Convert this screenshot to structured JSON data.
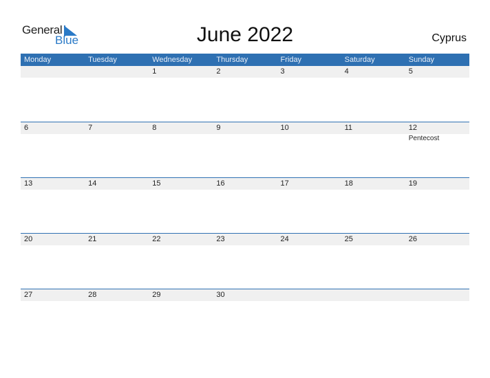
{
  "logo": {
    "word1": "General",
    "word2": "Blue"
  },
  "title": "June 2022",
  "country": "Cyprus",
  "colors": {
    "accent": "#2e70b2",
    "strip": "#f0f0f0"
  },
  "weekdays": [
    "Monday",
    "Tuesday",
    "Wednesday",
    "Thursday",
    "Friday",
    "Saturday",
    "Sunday"
  ],
  "weeks": [
    {
      "days": [
        "",
        "",
        "1",
        "2",
        "3",
        "4",
        "5"
      ],
      "holidays": [
        "",
        "",
        "",
        "",
        "",
        "",
        ""
      ]
    },
    {
      "days": [
        "6",
        "7",
        "8",
        "9",
        "10",
        "11",
        "12"
      ],
      "holidays": [
        "",
        "",
        "",
        "",
        "",
        "",
        "Pentecost"
      ]
    },
    {
      "days": [
        "13",
        "14",
        "15",
        "16",
        "17",
        "18",
        "19"
      ],
      "holidays": [
        "",
        "",
        "",
        "",
        "",
        "",
        ""
      ]
    },
    {
      "days": [
        "20",
        "21",
        "22",
        "23",
        "24",
        "25",
        "26"
      ],
      "holidays": [
        "",
        "",
        "",
        "",
        "",
        "",
        ""
      ]
    },
    {
      "days": [
        "27",
        "28",
        "29",
        "30",
        "",
        "",
        ""
      ],
      "holidays": [
        "",
        "",
        "",
        "",
        "",
        "",
        ""
      ]
    }
  ]
}
